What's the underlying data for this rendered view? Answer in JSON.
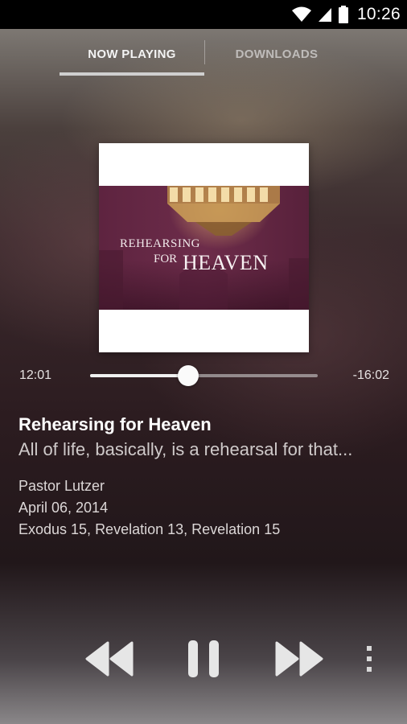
{
  "status_bar": {
    "time": "10:26",
    "icons": [
      "wifi-icon",
      "cell-signal-icon",
      "battery-icon"
    ]
  },
  "tabs": [
    {
      "label": "NOW PLAYING",
      "selected": true
    },
    {
      "label": "DOWNLOADS",
      "selected": false
    }
  ],
  "album_art": {
    "line1": "REHEARSING",
    "line2": "FOR",
    "line3": "HEAVEN"
  },
  "player": {
    "elapsed": "12:01",
    "remaining": "-16:02",
    "progress": 0.43
  },
  "episode": {
    "title": "Rehearsing for Heaven",
    "description": "All of life, basically, is a rehearsal for that...",
    "speaker": "Pastor Lutzer",
    "date": "April 06, 2014",
    "references": "Exodus 15, Revelation 13, Revelation 15"
  },
  "controls": {
    "icons": [
      "rewind-icon",
      "pause-icon",
      "fast-forward-icon",
      "more-vert-icon"
    ]
  },
  "colors": {
    "accent": "#cfcfcf",
    "album_bg": "#6d2c4a"
  }
}
